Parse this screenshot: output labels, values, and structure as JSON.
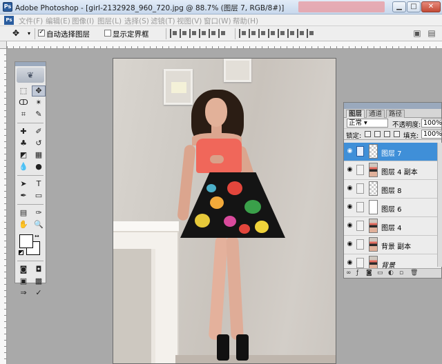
{
  "window": {
    "app_icon": "Ps",
    "title": "Adobe Photoshop - [girl-2132928_960_720.jpg @ 88.7% (图层 7, RGB/8#)]"
  },
  "menu": {
    "items": [
      "文件(F)",
      "编辑(E)",
      "图像(I)",
      "图层(L)",
      "选择(S)",
      "滤镜(T)",
      "视图(V)",
      "窗口(W)",
      "帮助(H)"
    ]
  },
  "options": {
    "auto_select_label": "自动选择图层",
    "show_bounds_label": "显示定界框",
    "auto_select_checked": true,
    "show_bounds_checked": false
  },
  "layers_panel": {
    "tabs": [
      "图层",
      "通道",
      "路径"
    ],
    "blend_mode": "正常",
    "opacity_label": "不透明度:",
    "opacity_value": "100%",
    "lock_label": "锁定:",
    "fill_label": "填充:",
    "fill_value": "100%",
    "layers": [
      {
        "name": "图层 7",
        "thumb": "checker",
        "selected": true
      },
      {
        "name": "图层 4 副本",
        "thumb": "photo",
        "selected": false
      },
      {
        "name": "图层 8",
        "thumb": "checker",
        "selected": false
      },
      {
        "name": "图层 6",
        "thumb": "white",
        "selected": false
      },
      {
        "name": "图层 4",
        "thumb": "photo",
        "selected": false
      },
      {
        "name": "背景 副本",
        "thumb": "photo",
        "selected": false
      },
      {
        "name": "背景",
        "thumb": "photo",
        "selected": false
      }
    ]
  },
  "colors": {
    "foreground": "#ffffff",
    "background": "#ffffff",
    "selection_blue": "#3f8fd8"
  }
}
